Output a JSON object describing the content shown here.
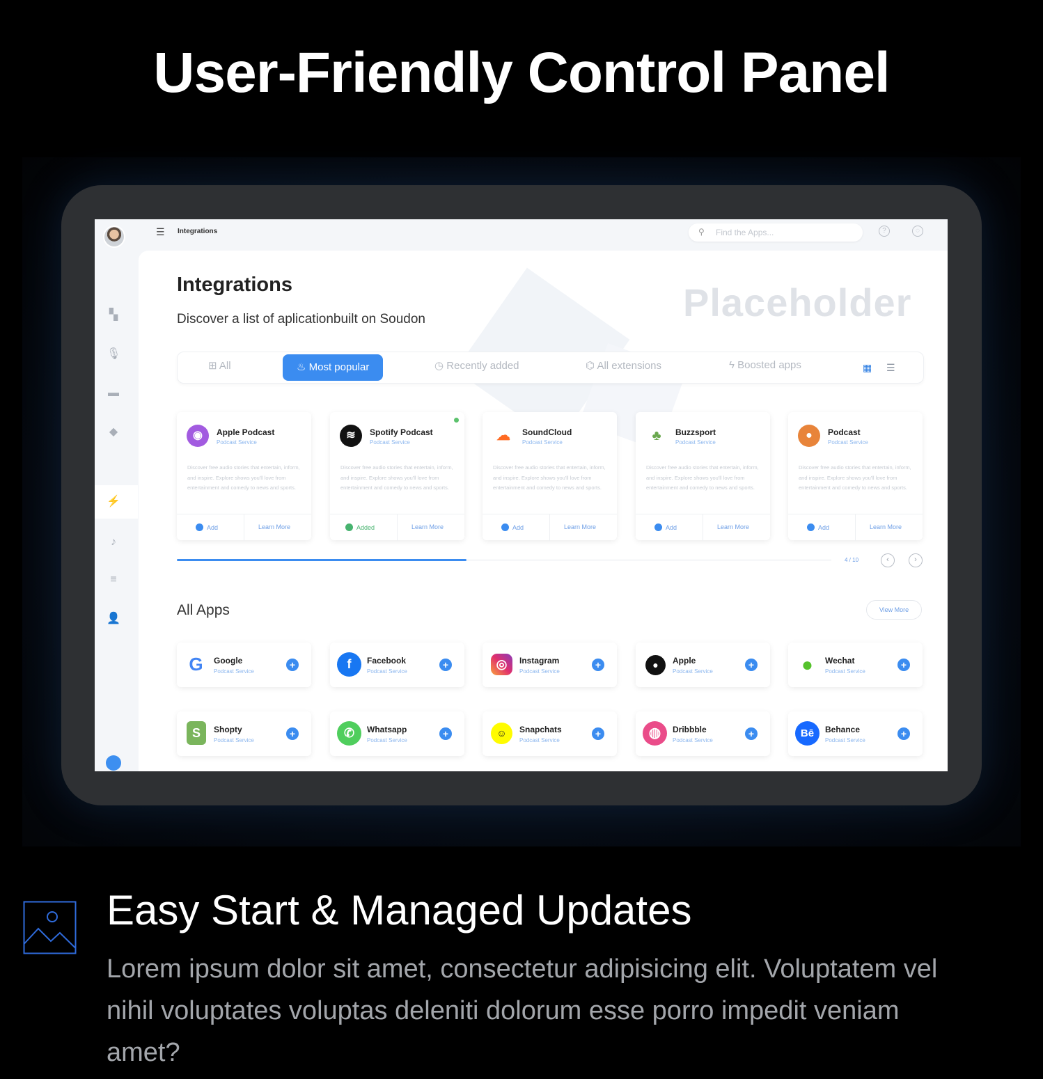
{
  "hero": {
    "title": "User-Friendly Control Panel"
  },
  "topbar": {
    "breadcrumb": "Integrations",
    "search_placeholder": "Find the Apps..."
  },
  "main": {
    "title": "Integrations",
    "subtitle": "Discover a list of aplicationbuilt on Soudon",
    "placeholder": "Placeholder",
    "tabs": [
      {
        "label": "All",
        "icon": "grid-icon"
      },
      {
        "label": "Most popular",
        "icon": "flame-icon"
      },
      {
        "label": "Recently added",
        "icon": "clock-icon"
      },
      {
        "label": "All extensions",
        "icon": "puzzle-icon"
      },
      {
        "label": "Boosted apps",
        "icon": "bolt-icon"
      }
    ],
    "popular_cards": [
      {
        "name": "Apple Podcast",
        "sub": "Podcast Service",
        "desc": "Discover free audio stories that entertain, inform, and inspire. Explore shows you'll love from entertainment and comedy to news and sports.",
        "action": "Add",
        "learn": "Learn More",
        "color": "#a25be0"
      },
      {
        "name": "Spotify Podcast",
        "sub": "Podcast Service",
        "desc": "Discover free audio stories that entertain, inform, and inspire. Explore shows you'll love from entertainment and comedy to news and sports.",
        "action": "Added",
        "learn": "Learn More",
        "color": "#111111"
      },
      {
        "name": "SoundCloud",
        "sub": "Podcast Service",
        "desc": "Discover free audio stories that entertain, inform, and inspire. Explore shows you'll love from entertainment and comedy to news and sports.",
        "action": "Add",
        "learn": "Learn More",
        "color": "#ff6a22"
      },
      {
        "name": "Buzzsport",
        "sub": "Podcast Service",
        "desc": "Discover free audio stories that entertain, inform, and inspire. Explore shows you'll love from entertainment and comedy to news and sports.",
        "action": "Add",
        "learn": "Learn More",
        "color": "#6aa84f"
      },
      {
        "name": "Podcast",
        "sub": "Podcast Service",
        "desc": "Discover free audio stories that entertain, inform, and inspire. Explore shows you'll love from entertainment and comedy to news and sports.",
        "action": "Add",
        "learn": "Learn More",
        "color": "#e8843a"
      }
    ],
    "pager": "4 / 10",
    "all_apps_title": "All Apps",
    "view_more": "View More",
    "apps": [
      {
        "name": "Google",
        "sub": "Podcast Service",
        "glyph": "G",
        "color": "#4285f4"
      },
      {
        "name": "Facebook",
        "sub": "Podcast Service",
        "glyph": "f",
        "color": "#1877f2"
      },
      {
        "name": "Instagram",
        "sub": "Podcast Service",
        "glyph": "◎",
        "color": "#e1306c"
      },
      {
        "name": "Apple",
        "sub": "Podcast Service",
        "glyph": "●",
        "color": "#111111"
      },
      {
        "name": "Wechat",
        "sub": "Podcast Service",
        "glyph": "●",
        "color": "#55c22c"
      },
      {
        "name": "Shopty",
        "sub": "Podcast Service",
        "glyph": "S",
        "color": "#7ab55c"
      },
      {
        "name": "Whatsapp",
        "sub": "Podcast Service",
        "glyph": "✆",
        "color": "#4fce5d"
      },
      {
        "name": "Snapchats",
        "sub": "Podcast Service",
        "glyph": "☺",
        "color": "#fffc00"
      },
      {
        "name": "Dribbble",
        "sub": "Podcast Service",
        "glyph": "◍",
        "color": "#ea4c89"
      },
      {
        "name": "Behance",
        "sub": "Podcast Service",
        "glyph": "Bē",
        "color": "#1769ff"
      }
    ]
  },
  "feature": {
    "title": "Easy Start & Managed Updates",
    "body": "Lorem ipsum dolor sit amet, consectetur adipisicing elit. Voluptatem vel nihil voluptates voluptas deleniti dolorum esse porro impedit veniam amet?"
  },
  "colors": {
    "accent": "#3b8cf0",
    "added": "#47b36f",
    "icon_outline": "#2f6bdb"
  }
}
